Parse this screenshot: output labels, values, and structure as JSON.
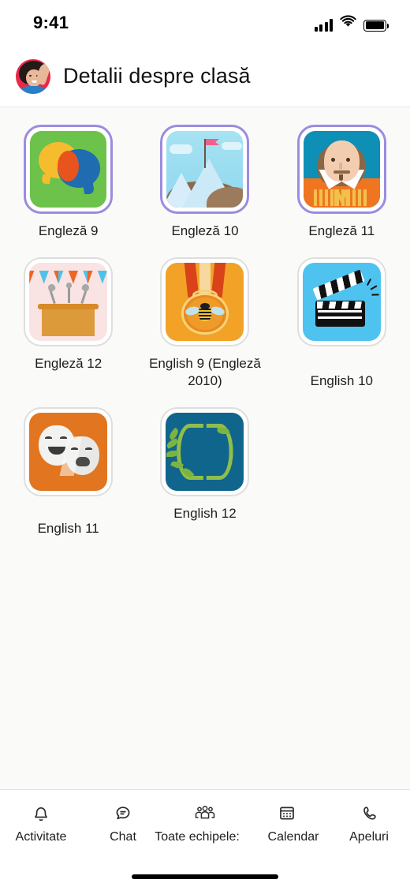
{
  "status_bar": {
    "time": "9:41",
    "signal_icon": "signal-bars-icon",
    "wifi_icon": "wifi-icon",
    "battery_icon": "battery-full-icon"
  },
  "header": {
    "avatar_name": "user-avatar",
    "title": "Detalii despre clasă"
  },
  "colors": {
    "ring_purple": "#9b8ce0",
    "ring_gray": "#dedede",
    "content_bg": "#fafaf9",
    "nav_icon": "#2b2b2b"
  },
  "classes": [
    {
      "label": "Engleză 9",
      "icon": "speech-bubbles-icon",
      "ring": "purple",
      "tile_color": "#6cc24a"
    },
    {
      "label": "Engleză 10",
      "icon": "mountain-flag-icon",
      "ring": "purple",
      "tile_color": "#8fd8ef"
    },
    {
      "label": "Engleză 11",
      "icon": "shakespeare-icon",
      "ring": "purple",
      "tile_color": "#0e8fb5"
    },
    {
      "label": "Engleză 12",
      "icon": "podium-microphones-icon",
      "ring": "gray",
      "tile_color": "#fae3e3"
    },
    {
      "label": "English 9 (Engleză 2010)",
      "icon": "spelling-bee-medal-icon",
      "ring": "gray",
      "tile_color": "#f2a227"
    },
    {
      "label": "English 10",
      "icon": "clapperboard-icon",
      "ring": "gray",
      "tile_color": "#4ec3ef"
    },
    {
      "label": "English 11",
      "icon": "theater-masks-icon",
      "ring": "gray",
      "tile_color": "#e2751f"
    },
    {
      "label": "English 12",
      "icon": "laurel-wreath-icon",
      "ring": "gray",
      "tile_color": "#10658c"
    }
  ],
  "bottom_nav": [
    {
      "label": "Activitate",
      "icon": "bell-icon"
    },
    {
      "label": "Chat",
      "icon": "chat-bubble-icon"
    },
    {
      "label": "Toate echipele:",
      "icon": "teams-people-icon"
    },
    {
      "label": "Calendar",
      "icon": "calendar-icon"
    },
    {
      "label": "Apeluri",
      "icon": "phone-call-icon"
    }
  ]
}
